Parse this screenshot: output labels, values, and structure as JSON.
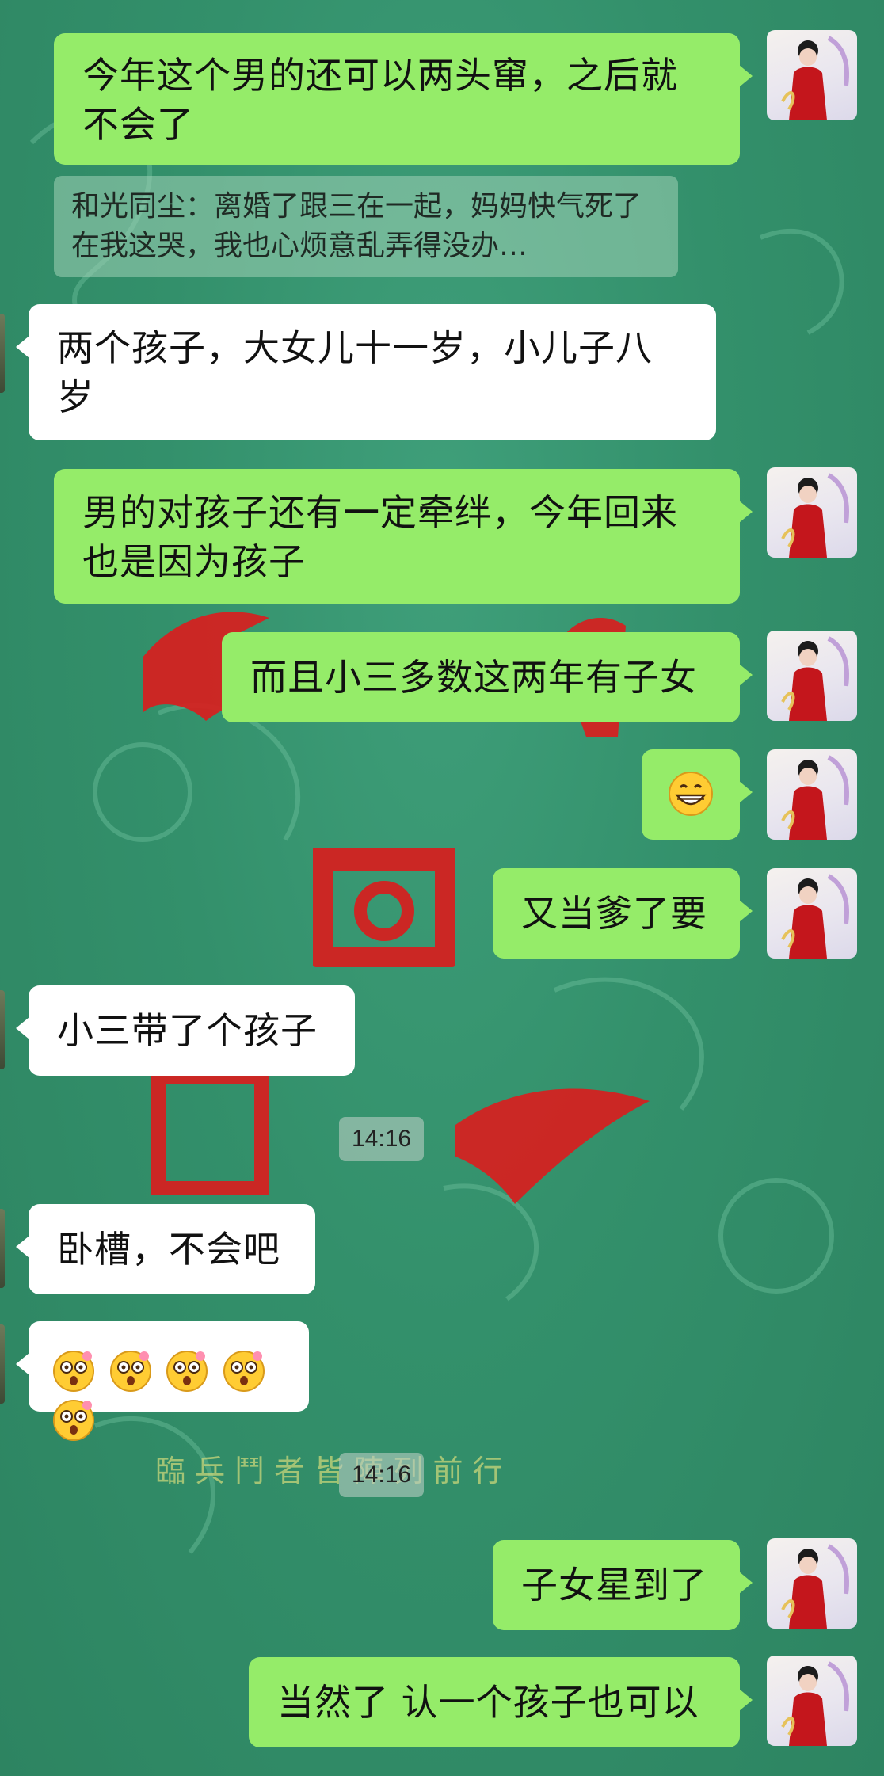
{
  "messages": [
    {
      "side": "out",
      "text": "今年这个男的还可以两头窜，之后就不会了"
    },
    {
      "side": "quote",
      "text": "和光同尘：离婚了跟三在一起，妈妈快气死了在我这哭，我也心烦意乱弄得没办…"
    },
    {
      "side": "in",
      "text": "两个孩子，大女儿十一岁，小儿子八岁"
    },
    {
      "side": "out",
      "text": "男的对孩子还有一定牵绊，今年回来也是因为孩子"
    },
    {
      "side": "out",
      "text": "而且小三多数这两年有子女"
    },
    {
      "side": "out",
      "emoji": "grinning-face"
    },
    {
      "side": "out",
      "text": "又当爹了要"
    },
    {
      "side": "in",
      "text": "小三带了个孩子"
    },
    {
      "side": "time",
      "text": "14:16"
    },
    {
      "side": "in",
      "text": "卧槽，不会吧"
    },
    {
      "side": "in",
      "emoji": "flushed-face x5"
    },
    {
      "side": "time",
      "text": "14:16"
    },
    {
      "side": "out",
      "text": "子女星到了"
    },
    {
      "side": "out",
      "text": "当然了 认一个孩子也可以"
    }
  ],
  "background": {
    "motto": "臨 兵 鬥 者 皆 陣 列 前 行",
    "main_color": "#34926d",
    "seal_red": "#d81e1e"
  },
  "colors": {
    "outgoing": "#95ec69",
    "incoming": "#ffffff"
  }
}
